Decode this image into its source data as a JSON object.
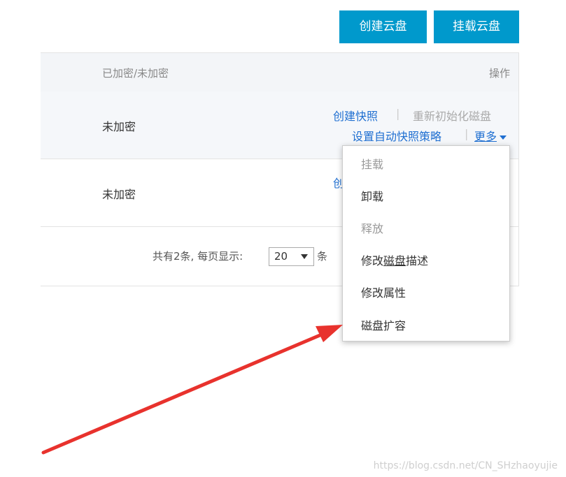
{
  "toolbar": {
    "create_label": "创建云盘",
    "mount_label": "挂载云盘"
  },
  "table": {
    "headers": {
      "encryption": "已加密/未加密",
      "operations": "操作"
    },
    "rows": [
      {
        "encryption": "未加密"
      },
      {
        "encryption": "未加密"
      }
    ],
    "row_ops": {
      "create_snapshot": "创建快照",
      "separator": "|",
      "reinit": "重新初始化磁盘",
      "auto_snapshot": "设置自动快照策略",
      "more": "更多",
      "row2_partial": "创"
    }
  },
  "pagination": {
    "total_text": "共有2条, 每页显示:",
    "page_size": "20",
    "unit": "条"
  },
  "dropdown": {
    "items": [
      {
        "label": "挂载",
        "disabled": true
      },
      {
        "label": "卸载",
        "disabled": false
      },
      {
        "label": "释放",
        "disabled": true
      },
      {
        "label": "修改磁盘描述",
        "disabled": false
      },
      {
        "label": "修改属性",
        "disabled": false
      },
      {
        "label": "磁盘扩容",
        "disabled": false
      }
    ],
    "desc_parts": [
      "修改",
      "磁盘",
      "描述"
    ]
  },
  "annotation": {
    "arrow_color": "#e8322d"
  },
  "watermark": "https://blog.csdn.net/CN_SHzhaoyujie",
  "colors": {
    "primary": "#0099cc",
    "link": "#1f6fd1",
    "disabled": "#aaaaaa"
  }
}
